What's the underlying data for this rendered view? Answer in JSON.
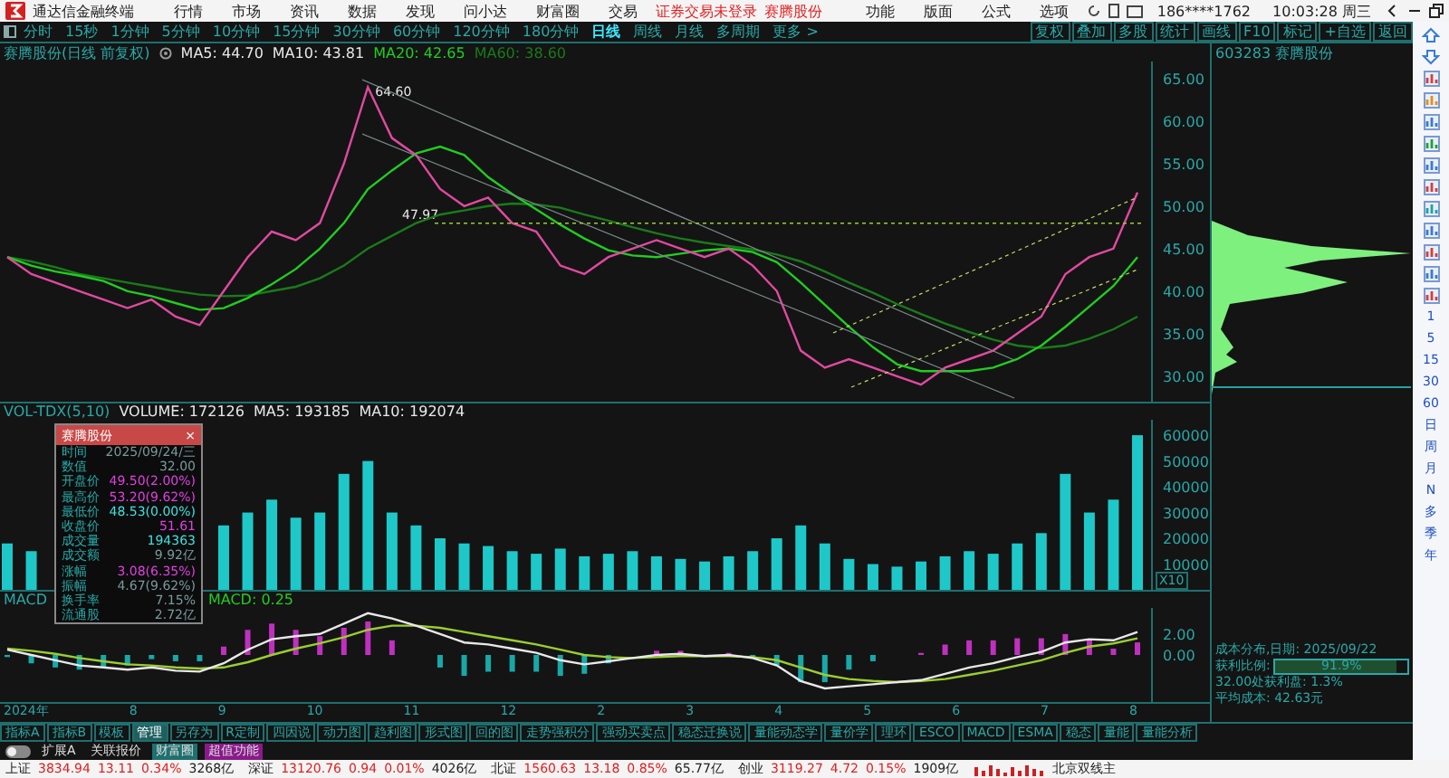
{
  "title_bar": {
    "app_name": "通达信金融终端",
    "menus": [
      "行情",
      "市场",
      "资讯",
      "数据",
      "发现",
      "问小达",
      "财富圈",
      "交易"
    ],
    "notice": "证券交易未登录",
    "notice_stock": "赛腾股份",
    "tools": [
      "功能",
      "版面",
      "公式",
      "选项"
    ],
    "account": "186****1762",
    "clock": "10:03:28 周三"
  },
  "period_tabs": [
    {
      "label": "分时",
      "selected": false
    },
    {
      "label": "15秒",
      "selected": false
    },
    {
      "label": "1分钟",
      "selected": false
    },
    {
      "label": "5分钟",
      "selected": false
    },
    {
      "label": "10分钟",
      "selected": false
    },
    {
      "label": "15分钟",
      "selected": false
    },
    {
      "label": "30分钟",
      "selected": false
    },
    {
      "label": "60分钟",
      "selected": false
    },
    {
      "label": "120分钟",
      "selected": false
    },
    {
      "label": "180分钟",
      "selected": false
    },
    {
      "label": "日线",
      "selected": true
    },
    {
      "label": "周线",
      "selected": false
    },
    {
      "label": "月线",
      "selected": false
    },
    {
      "label": "多周期",
      "selected": false
    },
    {
      "label": "更多 >",
      "selected": false
    }
  ],
  "chart_toolbar": [
    "复权",
    "叠加",
    "多股",
    "统计",
    "画线",
    "F10",
    "标记",
    "+自选",
    "返回"
  ],
  "stock_title": "603283 赛腾股份",
  "price_panel": {
    "title": "赛腾股份(日线 前复权)",
    "indicators": [
      {
        "label": "MA5: 44.70",
        "color": "#e8e8e8"
      },
      {
        "label": "MA10: 43.81",
        "color": "#e8e8e8"
      },
      {
        "label": "MA20: 42.65",
        "color": "#22cc22"
      },
      {
        "label": "MA60: 38.60",
        "color": "#1a7a1a"
      }
    ],
    "chart_data": {
      "type": "line",
      "series": [
        {
          "color": "#e04aa0",
          "values": [
            44,
            42,
            41,
            40,
            39,
            38,
            39,
            37,
            36,
            40,
            44,
            47,
            46,
            48,
            55,
            64,
            58,
            56,
            52,
            50,
            51,
            48,
            47,
            43,
            42,
            44,
            45,
            46,
            45,
            44,
            45,
            43,
            40,
            33,
            31,
            32,
            31,
            30,
            29,
            31,
            32,
            33,
            35,
            37,
            42,
            44,
            45,
            51.6
          ]
        },
        {
          "color": "#22cc22",
          "values": [
            44,
            43,
            42.3,
            41.8,
            41.2,
            40,
            39.4,
            38.6,
            37.8,
            38,
            39.2,
            40.8,
            42.6,
            45,
            48,
            52,
            54.2,
            56.2,
            57,
            56,
            53.4,
            51.4,
            49.6,
            47.8,
            46.2,
            44.8,
            44.2,
            44,
            44.4,
            44.8,
            45,
            44.6,
            43.4,
            41,
            38.4,
            35.8,
            33.4,
            31.4,
            30.6,
            30.6,
            30.6,
            31,
            32,
            33.6,
            35.8,
            38.2,
            40.6,
            44
          ]
        },
        {
          "color": "#1a7a1a",
          "values": [
            44,
            43.5,
            42.8,
            42,
            41.5,
            41,
            40.5,
            40,
            39.6,
            39.4,
            39.5,
            40,
            40.5,
            41.5,
            43,
            45,
            46.5,
            48,
            49,
            49.5,
            50,
            50.3,
            50.2,
            49.8,
            49,
            48.3,
            47.5,
            46.8,
            46.2,
            45.7,
            45.3,
            44.9,
            44.3,
            43.5,
            42.3,
            41,
            39.8,
            38.5,
            37.3,
            36.2,
            35.2,
            34.3,
            33.6,
            33.3,
            33.6,
            34.4,
            35.5,
            37
          ]
        }
      ],
      "ylim": [
        27,
        67
      ],
      "yticks": [
        {
          "value": 65,
          "label": "65.00"
        },
        {
          "value": 60,
          "label": "60.00"
        },
        {
          "value": 55,
          "label": "55.00"
        },
        {
          "value": 50,
          "label": "50.00"
        },
        {
          "value": 45,
          "label": "45.00"
        },
        {
          "value": 40,
          "label": "40.00"
        },
        {
          "value": 35,
          "label": "35.00"
        },
        {
          "value": 30,
          "label": "30.00"
        }
      ],
      "annotations": [
        "64.60",
        "47.97"
      ]
    }
  },
  "volume_panel": {
    "title": "VOL-TDX(5,10)",
    "indicators": [
      {
        "label": "VOLUME: 172126",
        "color": "#e8e8e8"
      },
      {
        "label": "MA5: 193185",
        "color": "#e8e8e8"
      },
      {
        "label": "MA10: 192074",
        "color": "#e8e8e8"
      }
    ],
    "scale_label": "X10",
    "chart_data": {
      "type": "bar",
      "categories": [
        null,
        null,
        null,
        null,
        null,
        null,
        null,
        null,
        null,
        null,
        null,
        null,
        null,
        null,
        null,
        null,
        null,
        null,
        null,
        null,
        null,
        null,
        null,
        null,
        null,
        null,
        null,
        null,
        null,
        null,
        null,
        null,
        null,
        null,
        null,
        null,
        null,
        null,
        null,
        null,
        null,
        null,
        null,
        null,
        null,
        null,
        null,
        null
      ],
      "series": [
        {
          "color": "#1fc8c8",
          "values": [
            18000,
            15000,
            null,
            null,
            null,
            null,
            null,
            null,
            null,
            25000,
            30000,
            35000,
            28000,
            30000,
            45000,
            50000,
            30000,
            25000,
            20000,
            18000,
            17000,
            15000,
            14000,
            16000,
            13000,
            14000,
            15000,
            13000,
            12000,
            11000,
            13000,
            15000,
            20000,
            25000,
            18000,
            12000,
            10000,
            9000,
            11000,
            13000,
            15000,
            14000,
            18000,
            22000,
            45000,
            30000,
            35000,
            60000
          ]
        }
      ],
      "ylim": [
        0,
        66000
      ],
      "yticks": [
        {
          "value": 60000,
          "label": "60000"
        },
        {
          "value": 50000,
          "label": "50000"
        },
        {
          "value": 40000,
          "label": "40000"
        },
        {
          "value": 30000,
          "label": "30000"
        },
        {
          "value": 20000,
          "label": "20000"
        },
        {
          "value": 10000,
          "label": "10000"
        }
      ]
    }
  },
  "macd_panel": {
    "title": "MACD",
    "indicators": [
      {
        "label": "MACD: 0.25",
        "color": "#22cc22"
      }
    ],
    "chart_data": {
      "type": "line",
      "series": [
        {
          "color": "#e8e8e8",
          "values": [
            0.5,
            0,
            -0.5,
            -1,
            -1.2,
            -1.4,
            -1.2,
            -1.5,
            -1.6,
            -0.8,
            0.5,
            1.5,
            1.8,
            2,
            3,
            4,
            3.5,
            2.8,
            2,
            1.2,
            1,
            0.6,
            0.2,
            -0.5,
            -0.9,
            -0.6,
            -0.3,
            0,
            0.1,
            -0.1,
            0,
            -0.3,
            -1,
            -2.5,
            -3.2,
            -3,
            -2.8,
            -2.6,
            -2.4,
            -1.8,
            -1.2,
            -0.8,
            -0.2,
            0.3,
            1.2,
            1.5,
            1.4,
            2.2
          ]
        },
        {
          "color": "#9acd32",
          "values": [
            0.6,
            0.4,
            0.1,
            -0.3,
            -0.6,
            -0.9,
            -1,
            -1.2,
            -1.3,
            -1.2,
            -0.7,
            0,
            0.6,
            1.1,
            1.7,
            2.4,
            2.8,
            2.8,
            2.6,
            2.2,
            1.8,
            1.4,
            1,
            0.5,
            0,
            -0.2,
            -0.3,
            -0.2,
            -0.1,
            -0.1,
            -0.1,
            -0.2,
            -0.5,
            -1.2,
            -1.9,
            -2.3,
            -2.5,
            -2.6,
            -2.5,
            -2.3,
            -1.9,
            -1.5,
            -1,
            -0.5,
            0.2,
            0.8,
            1.1,
            1.6
          ]
        }
      ],
      "ylim": [
        -4.5,
        4.5
      ],
      "yticks": [
        {
          "value": 2,
          "label": "2.00"
        },
        {
          "value": 0,
          "label": "0.00"
        }
      ]
    }
  },
  "date_axis": [
    "2024年",
    "8",
    "9",
    "10",
    "11",
    "12",
    "2",
    "3",
    "4",
    "5",
    "6",
    "7",
    "8"
  ],
  "info_popup": {
    "title": "赛腾股份",
    "close": "×",
    "rows": [
      {
        "label": "时间",
        "value": "2025/09/24/三",
        "color": "#7a9a9a"
      },
      {
        "label": "数值",
        "value": "32.00",
        "color": "#7a9a9a"
      },
      {
        "label": "开盘价",
        "value": "49.50(2.00%)",
        "color": "#e040e0"
      },
      {
        "label": "最高价",
        "value": "53.20(9.62%)",
        "color": "#e040e0"
      },
      {
        "label": "最低价",
        "value": "48.53(0.00%)",
        "color": "#40e0e0"
      },
      {
        "label": "收盘价",
        "value": "51.61",
        "color": "#e040e0"
      },
      {
        "label": "成交量",
        "value": "194363",
        "color": "#40e0e0"
      },
      {
        "label": "成交额",
        "value": "9.92亿",
        "color": "#7a9a9a"
      },
      {
        "label": "涨幅",
        "value": "3.08(6.35%)",
        "color": "#e040e0"
      },
      {
        "label": "振幅",
        "value": "4.67(9.62%)",
        "color": "#7a9a9a"
      },
      {
        "label": "换手率",
        "value": "7.15%",
        "color": "#7a9a9a"
      },
      {
        "label": "流通股",
        "value": "2.72亿",
        "color": "#7a9a9a"
      }
    ]
  },
  "chip_panel": {
    "date_label": "成本分布,日期: 2025/09/22",
    "profit_label": "获利比例:",
    "profit_value": "91.9%",
    "level": 0.919,
    "lines": [
      "32.00处获利盘: 1.3%",
      "平均成本: 42.63元"
    ]
  },
  "side_periods": [
    "1",
    "5",
    "15",
    "30",
    "60",
    "日",
    "周",
    "月",
    "N",
    "多",
    "季",
    "年"
  ],
  "bottom_tabs": [
    {
      "label": "指标A",
      "selected": false
    },
    {
      "label": "指标B",
      "selected": false
    },
    {
      "label": "模板",
      "selected": false
    },
    {
      "label": "管理",
      "selected": true
    },
    {
      "label": "另存为",
      "selected": false
    },
    {
      "label": "R定制",
      "selected": false
    },
    {
      "label": "四因说",
      "selected": false
    },
    {
      "label": "动力图",
      "selected": false
    },
    {
      "label": "趋利图",
      "selected": false
    },
    {
      "label": "形式图",
      "selected": false
    },
    {
      "label": "回的图",
      "selected": false
    },
    {
      "label": "走势强积分",
      "selected": false
    },
    {
      "label": "强动买卖点",
      "selected": false
    },
    {
      "label": "稳态迁换说",
      "selected": false
    },
    {
      "label": "量能动态学",
      "selected": false
    },
    {
      "label": "量价学",
      "selected": false
    },
    {
      "label": "理环",
      "selected": false
    },
    {
      "label": "ESCO",
      "selected": false
    },
    {
      "label": "MACD",
      "selected": false
    },
    {
      "label": "ESMA",
      "selected": false
    },
    {
      "label": "稳态",
      "selected": false
    },
    {
      "label": "量能",
      "selected": false
    },
    {
      "label": "量能分析",
      "selected": false
    }
  ],
  "bottom_row": {
    "toggle_on": false,
    "items": [
      {
        "label": "扩展A"
      },
      {
        "label": "关联报价"
      },
      {
        "label": "财富圈",
        "color": "#1f6f6f"
      },
      {
        "label": "超值功能",
        "color": "#8a1a8a"
      }
    ]
  },
  "status_bar": {
    "indices": [
      {
        "name": "上证",
        "value": "3834.94",
        "change": "13.11",
        "percent": "0.34%",
        "amount": "3268亿"
      },
      {
        "name": "深证",
        "value": "13120.76",
        "change": "0.94",
        "percent": "0.01%",
        "amount": "4026亿"
      },
      {
        "name": "北证",
        "value": "1560.63",
        "change": "13.18",
        "percent": "0.85%",
        "amount": "65.77亿"
      },
      {
        "name": "创业",
        "value": "3119.27",
        "change": "4.72",
        "percent": "0.15%",
        "amount": "1909亿"
      }
    ],
    "ticker": "北京双线主"
  }
}
